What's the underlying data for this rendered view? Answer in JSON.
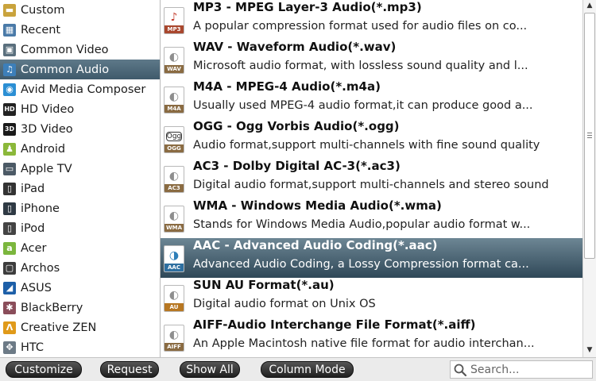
{
  "categories": [
    {
      "label": "Custom",
      "icon": "folder-icon",
      "color": "#c9a33c",
      "glyph": "▬"
    },
    {
      "label": "Recent",
      "icon": "recent-grid-icon",
      "color": "#4a7aa8",
      "glyph": "▦"
    },
    {
      "label": "Common Video",
      "icon": "film-icon",
      "color": "#5a6f7d",
      "glyph": "▣"
    },
    {
      "label": "Common Audio",
      "icon": "music-note-icon",
      "color": "#3d7fb9",
      "glyph": "♫",
      "selected": true
    },
    {
      "label": "Avid Media Composer",
      "icon": "avid-icon",
      "color": "#2b8fd4",
      "glyph": "◉"
    },
    {
      "label": "HD Video",
      "icon": "hd-icon",
      "color": "#222222",
      "glyph": "HD"
    },
    {
      "label": "3D Video",
      "icon": "3d-icon",
      "color": "#1a1a1a",
      "glyph": "3D"
    },
    {
      "label": "Android",
      "icon": "android-icon",
      "color": "#8bb83a",
      "glyph": "♟"
    },
    {
      "label": "Apple TV",
      "icon": "tv-icon",
      "color": "#4c5a66",
      "glyph": "▭"
    },
    {
      "label": "iPad",
      "icon": "ipad-icon",
      "color": "#333333",
      "glyph": "▯"
    },
    {
      "label": "iPhone",
      "icon": "iphone-icon",
      "color": "#2f3a44",
      "glyph": "▯"
    },
    {
      "label": "iPod",
      "icon": "ipod-icon",
      "color": "#444444",
      "glyph": "▯"
    },
    {
      "label": "Acer",
      "icon": "acer-icon",
      "color": "#7bb63d",
      "glyph": "a"
    },
    {
      "label": "Archos",
      "icon": "archos-icon",
      "color": "#3d3d3d",
      "glyph": "▢"
    },
    {
      "label": "ASUS",
      "icon": "asus-icon",
      "color": "#1d5fa8",
      "glyph": "◢"
    },
    {
      "label": "BlackBerry",
      "icon": "blackberry-icon",
      "color": "#8a4d5a",
      "glyph": "✱"
    },
    {
      "label": "Creative ZEN",
      "icon": "creative-zen-icon",
      "color": "#e09a1a",
      "glyph": "Λ"
    },
    {
      "label": "HTC",
      "icon": "htc-icon",
      "color": "#6c7a86",
      "glyph": "✥"
    }
  ],
  "formats": [
    {
      "name": "MP3 - MPEG Layer-3 Audio(*.mp3)",
      "desc": "A popular compression format used for audio files on co...",
      "tag": "MP3",
      "icon": "mp3-file-icon",
      "tagcolor": "#a9472e",
      "glyph": "♪",
      "glyphcolor": "#c23a2a"
    },
    {
      "name": "WAV - Waveform Audio(*.wav)",
      "desc": "Microsoft audio format, with lossless sound quality and l...",
      "tag": "WAV",
      "icon": "wav-file-icon",
      "tagcolor": "#8a6b42",
      "glyph": "◐",
      "glyphcolor": "#8e8e8e"
    },
    {
      "name": "M4A - MPEG-4 Audio(*.m4a)",
      "desc": "Usually used MPEG-4 audio format,it can produce good a...",
      "tag": "M4A",
      "icon": "m4a-file-icon",
      "tagcolor": "#8a6b42",
      "glyph": "◐",
      "glyphcolor": "#8e8e8e"
    },
    {
      "name": "OGG - Ogg Vorbis Audio(*.ogg)",
      "desc": "Audio format,support multi-channels with fine sound quality",
      "tag": "OGG",
      "icon": "ogg-file-icon",
      "tagcolor": "#8a6b42",
      "glyph": "Ogg",
      "glyphcolor": "#222222"
    },
    {
      "name": "AC3 - Dolby Digital AC-3(*.ac3)",
      "desc": "Digital audio format,support multi-channels and stereo sound",
      "tag": "AC3",
      "icon": "ac3-file-icon",
      "tagcolor": "#8a6b42",
      "glyph": "◐",
      "glyphcolor": "#8e8e8e"
    },
    {
      "name": "WMA - Windows Media Audio(*.wma)",
      "desc": "Stands for Windows Media Audio,popular audio format w...",
      "tag": "WMA",
      "icon": "wma-file-icon",
      "tagcolor": "#8a6b42",
      "glyph": "◐",
      "glyphcolor": "#8e8e8e"
    },
    {
      "name": "AAC - Advanced Audio Coding(*.aac)",
      "desc": "Advanced Audio Coding, a Lossy Compression format ca...",
      "tag": "AAC",
      "icon": "aac-file-icon",
      "tagcolor": "#2e6fa0",
      "glyph": "◑",
      "glyphcolor": "#2e7fb8",
      "selected": true
    },
    {
      "name": "SUN AU Format(*.au)",
      "desc": "Digital audio format on Unix OS",
      "tag": "AU",
      "icon": "au-file-icon",
      "tagcolor": "#b77722",
      "glyph": "◐",
      "glyphcolor": "#8e8e8e"
    },
    {
      "name": "AIFF-Audio Interchange File Format(*.aiff)",
      "desc": "An Apple Macintosh native file format for audio interchan...",
      "tag": "AIFF",
      "icon": "aiff-file-icon",
      "tagcolor": "#8a6b42",
      "glyph": "◐",
      "glyphcolor": "#8e8e8e"
    }
  ],
  "buttons": {
    "customize": "Customize",
    "request": "Request",
    "show_all": "Show All",
    "column_mode": "Column Mode"
  },
  "search": {
    "placeholder": "Search...",
    "value": "",
    "icon": "search-icon"
  },
  "scrollbar": {
    "up": "▲",
    "down": "▼"
  },
  "colors": {
    "selection_top": "#5e7989",
    "selection_bottom": "#3f5a6b"
  }
}
